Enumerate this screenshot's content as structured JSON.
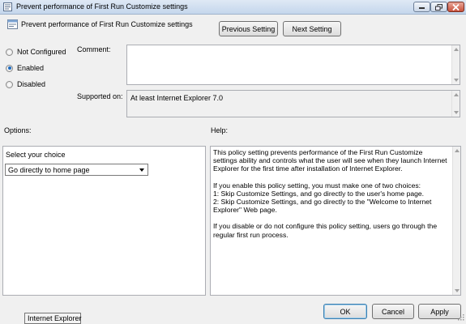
{
  "window": {
    "title": "Prevent performance of First Run Customize settings",
    "icon": "policy-icon",
    "controls": [
      "minimize-icon",
      "restore-icon",
      "close-icon"
    ]
  },
  "header": {
    "title": "Prevent performance of First Run Customize settings",
    "icon": "policy-setting-icon",
    "previous_label": "Previous Setting",
    "next_label": "Next Setting"
  },
  "state": {
    "options": [
      "Not Configured",
      "Enabled",
      "Disabled"
    ],
    "selected": "Enabled"
  },
  "comment": {
    "label": "Comment:",
    "value": ""
  },
  "supported": {
    "label": "Supported on:",
    "value": "At least Internet Explorer 7.0"
  },
  "options_panel": {
    "label": "Options:",
    "choice_label": "Select your choice",
    "choice_value": "Go directly to home page"
  },
  "help_panel": {
    "label": "Help:",
    "paragraphs": [
      "This policy setting prevents performance of the First Run Customize settings ability and controls what the user will see when they launch Internet Explorer for the first time after installation of Internet Explorer.",
      "If you enable this policy setting, you must make one of two choices:\n1: Skip Customize Settings, and go directly to the user's home page.\n2: Skip Customize Settings, and go directly to the \"Welcome to Internet Explorer\" Web page.",
      "If you disable or do not configure this policy setting, users go through the regular first run process."
    ]
  },
  "footer": {
    "ok_label": "OK",
    "cancel_label": "Cancel",
    "apply_label": "Apply",
    "tooltip": "Internet Explorer"
  },
  "colors": {
    "titlebar": "#c4d6ec",
    "dialog_bg": "#f0f0f0",
    "close_button": "#c8513c",
    "radio_accent": "#1f6bbf"
  }
}
